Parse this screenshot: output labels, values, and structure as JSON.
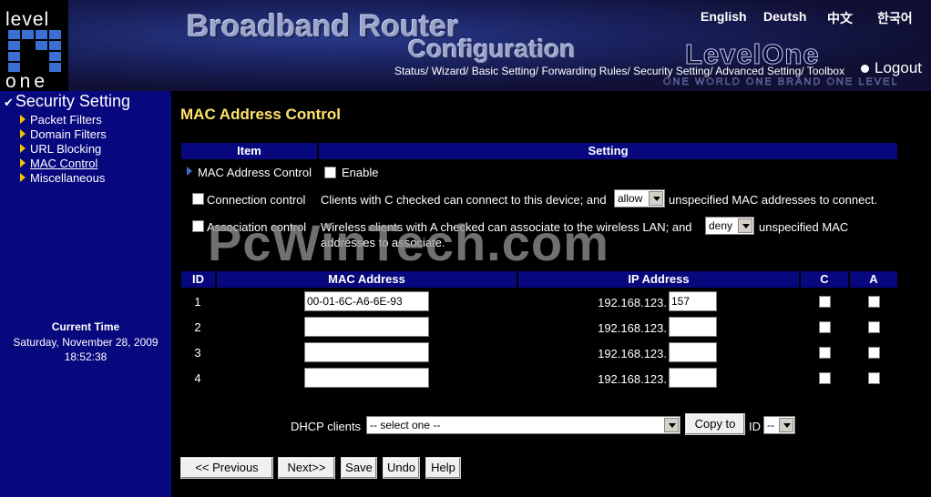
{
  "header": {
    "logo_top": "level",
    "logo_bottom": "one",
    "title_line1": "Broadband Router",
    "title_line2": "Configuration",
    "brand": "LevelOne",
    "tagline": "ONE WORLD ONE BRAND ONE LEVEL",
    "languages": [
      "English",
      "Deutsh",
      "中文",
      "한국어"
    ],
    "nav": [
      "Status/",
      "Wizard/",
      "Basic Setting/",
      "Forwarding Rules/",
      "Security Setting/",
      "Advanced Setting/",
      "Toolbox"
    ],
    "logout": "Logout"
  },
  "sidebar": {
    "title": "Security Setting",
    "items": [
      {
        "label": "Packet Filters"
      },
      {
        "label": "Domain Filters"
      },
      {
        "label": "URL Blocking"
      },
      {
        "label": "MAC Control"
      },
      {
        "label": "Miscellaneous"
      }
    ],
    "time_label": "Current Time",
    "time_date": "Saturday, November 28, 2009",
    "time_clock": "18:52:38"
  },
  "main": {
    "title": "MAC Address Control",
    "settings_header": {
      "item": "Item",
      "setting": "Setting"
    },
    "mac_control": {
      "label": "MAC Address Control",
      "enable_label": "Enable"
    },
    "connection": {
      "label": "Connection control",
      "text_before": "Clients with C checked can connect to this device; and",
      "select_value": "allow",
      "text_after": "unspecified MAC addresses to connect."
    },
    "association": {
      "label": "Association control",
      "text_before": "Wireless clients with A checked can associate to the wireless LAN; and",
      "select_value": "deny",
      "text_after": "unspecified MAC",
      "text_line2": "addresses to associate."
    },
    "table_header": {
      "id": "ID",
      "mac": "MAC Address",
      "ip": "IP Address",
      "c": "C",
      "a": "A"
    },
    "rows": [
      {
        "id": "1",
        "mac": "00-01-6C-A6-6E-93",
        "ip_prefix": "192.168.123.",
        "ip_last": "157"
      },
      {
        "id": "2",
        "mac": "",
        "ip_prefix": "192.168.123.",
        "ip_last": ""
      },
      {
        "id": "3",
        "mac": "",
        "ip_prefix": "192.168.123.",
        "ip_last": ""
      },
      {
        "id": "4",
        "mac": "",
        "ip_prefix": "192.168.123.",
        "ip_last": ""
      }
    ],
    "dhcp": {
      "label": "DHCP clients",
      "select_value": "-- select one --",
      "copy_button": "Copy to",
      "id_label": "ID",
      "id_select": "--"
    },
    "buttons": {
      "previous": "<< Previous",
      "next": "Next>>",
      "save": "Save",
      "undo": "Undo",
      "help": "Help"
    }
  },
  "watermark": "PcWinTech.com"
}
